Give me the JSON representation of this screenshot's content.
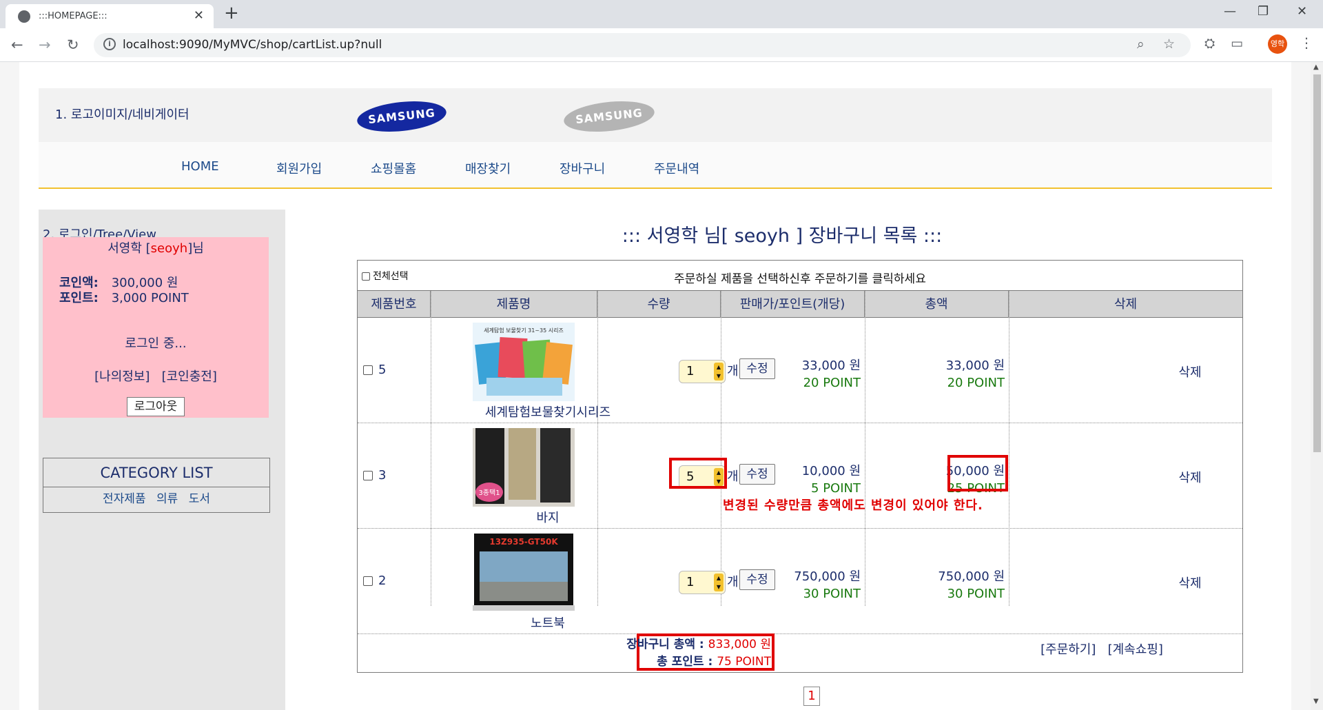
{
  "browser": {
    "tab_title": ":::HOMEPAGE:::",
    "url": "localhost:9090/MyMVC/shop/cartList.up?null",
    "profile_initials": "영학"
  },
  "header": {
    "logo_label": "1. 로고이미지/네비게이터",
    "logo1_text": "SAMSUNG",
    "logo2_text": "SAMSUNG"
  },
  "nav": {
    "items": [
      "HOME",
      "회원가입",
      "쇼핑몰홈",
      "매장찾기",
      "장바구니",
      "주문내역"
    ]
  },
  "sidebar": {
    "label": "2. 로그인/Tree/View",
    "user_name": "서영학",
    "user_id": "seoyh",
    "user_suffix": "님",
    "coin_label": "코인액:",
    "coin_value": "300,000 원",
    "point_label": "포인트:",
    "point_value": "3,000 POINT",
    "status": "로그인 중...",
    "link_myinfo": "[나의정보]",
    "link_coin": "[코인충전]",
    "logout": "로그아웃",
    "category_title": "CATEGORY LIST",
    "categories": [
      "전자제품",
      "의류",
      "도서"
    ]
  },
  "main": {
    "title": "::: 서영학 님[ seoyh ] 장바구니 목록 :::",
    "select_all": "전체선택",
    "instruction": "주문하실 제품을 선택하신후 주문하기를 클릭하세요",
    "columns": [
      "제품번호",
      "제품명",
      "수량",
      "판매가/포인트(개당)",
      "총액",
      "삭제"
    ],
    "rows": [
      {
        "no": "5",
        "name": "세계탐험보물찾기시리즈",
        "qty": "1",
        "unit": "개",
        "modify": "수정",
        "price": "33,000 원",
        "price_point": "20 POINT",
        "total": "33,000 원",
        "total_point": "20 POINT",
        "delete": "삭제",
        "img_text": "세계탐험 보물찾기 31~35 시리즈"
      },
      {
        "no": "3",
        "name": "바지",
        "qty": "5",
        "unit": "개",
        "modify": "수정",
        "price": "10,000 원",
        "price_point": "5 POINT",
        "total": "50,000 원",
        "total_point": "25 POINT",
        "delete": "삭제",
        "img_text": "3종택1"
      },
      {
        "no": "2",
        "name": "노트북",
        "qty": "1",
        "unit": "개",
        "modify": "수정",
        "price": "750,000 원",
        "price_point": "30 POINT",
        "total": "750,000 원",
        "total_point": "30 POINT",
        "delete": "삭제",
        "img_text": "13Z935-GT50K"
      }
    ],
    "note": "변경된 수량만큼 총액에도 변경이 있어야 한다.",
    "cart_total_label": "장바구니 총액 : ",
    "cart_total_value": "833,000 원",
    "total_point_label": "총 포인트 : ",
    "total_point_value": "75 POINT",
    "order_link": "[주문하기]",
    "continue_link": "[계속쇼핑]",
    "page": "1"
  },
  "colors": {
    "accent_red": "#e00000",
    "login_box": "#ffc0cb",
    "nav_underline": "#f2c12e",
    "point_green": "#1a7a10"
  }
}
